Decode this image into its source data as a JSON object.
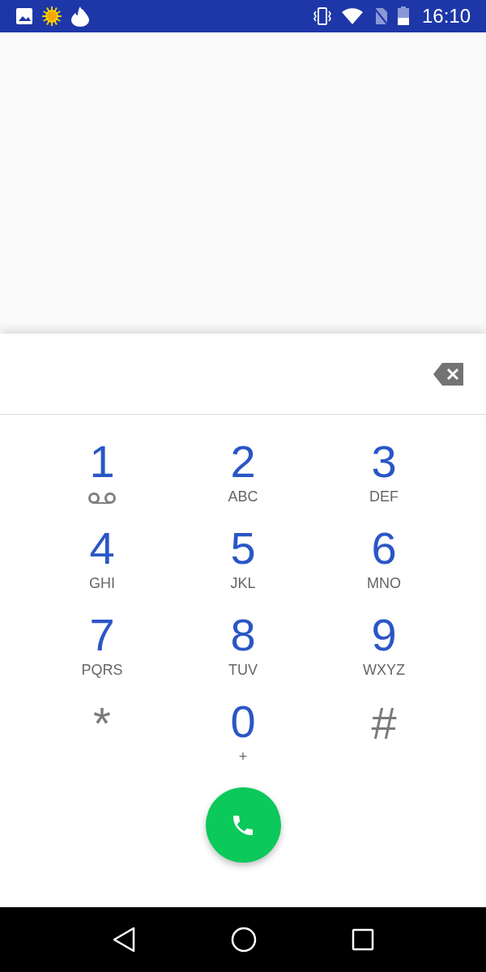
{
  "status_bar": {
    "time": "16:10"
  },
  "keys": [
    {
      "kind": "digit",
      "label": "1",
      "voicemail": true
    },
    {
      "kind": "digit",
      "label": "2",
      "letters": "ABC"
    },
    {
      "kind": "digit",
      "label": "3",
      "letters": "DEF"
    },
    {
      "kind": "digit",
      "label": "4",
      "letters": "GHI"
    },
    {
      "kind": "digit",
      "label": "5",
      "letters": "JKL"
    },
    {
      "kind": "digit",
      "label": "6",
      "letters": "MNO"
    },
    {
      "kind": "digit",
      "label": "7",
      "letters": "PQRS"
    },
    {
      "kind": "digit",
      "label": "8",
      "letters": "TUV"
    },
    {
      "kind": "digit",
      "label": "9",
      "letters": "WXYZ"
    },
    {
      "kind": "symbol",
      "label": "*"
    },
    {
      "kind": "digit",
      "label": "0",
      "letters": "+"
    },
    {
      "kind": "symbol",
      "label": "#"
    }
  ]
}
